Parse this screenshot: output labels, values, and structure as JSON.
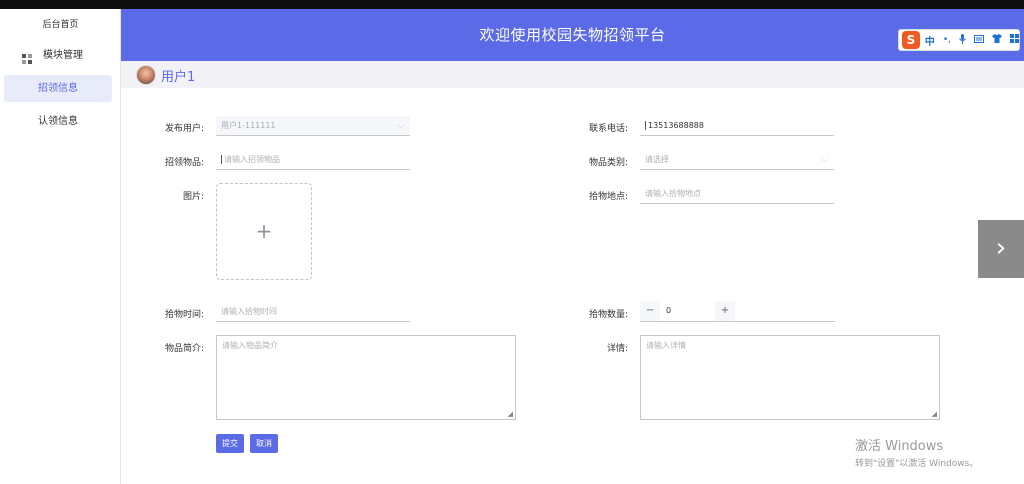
{
  "sidebar": {
    "home": "后台首页",
    "items": [
      {
        "label": "模块管理"
      },
      {
        "label": "招领信息"
      },
      {
        "label": "认领信息"
      }
    ]
  },
  "header": {
    "title": "欢迎使用校园失物招领平台",
    "ime": {
      "logo": "S",
      "lang": "中",
      "icons": [
        "punctuation-icon",
        "mic-icon",
        "keyboard-icon",
        "shirt-icon",
        "grid-icon"
      ]
    }
  },
  "user": {
    "name": "用户1"
  },
  "form": {
    "publisher": {
      "label": "发布用户:",
      "value": "用户1-111111"
    },
    "phone": {
      "label": "联系电话:",
      "value": "13513688888"
    },
    "item_name": {
      "label": "招领物品:",
      "placeholder": "请输入招领物品"
    },
    "category": {
      "label": "物品类别:",
      "placeholder": "请选择"
    },
    "image": {
      "label": "图片:",
      "plus": "+"
    },
    "place": {
      "label": "拾物地点:",
      "placeholder": "请输入拾物地点"
    },
    "time": {
      "label": "拾物时间:",
      "placeholder": "请输入拾物时间"
    },
    "quantity": {
      "label": "拾物数量:",
      "value": "0",
      "minus": "−",
      "plus": "+"
    },
    "intro": {
      "label": "物品简介:",
      "placeholder": "请输入物品简介"
    },
    "detail": {
      "label": "详情:",
      "placeholder": "请输入详情"
    },
    "submit_label": "提交",
    "cancel_label": "取消"
  },
  "nav": {
    "next_arrow": "›"
  },
  "watermark": {
    "line1": "激活 Windows",
    "line2": "转到\"设置\"以激活 Windows。"
  },
  "colors": {
    "accent": "#5b6ae6",
    "sidebar_active_bg": "#e8ebfa"
  }
}
